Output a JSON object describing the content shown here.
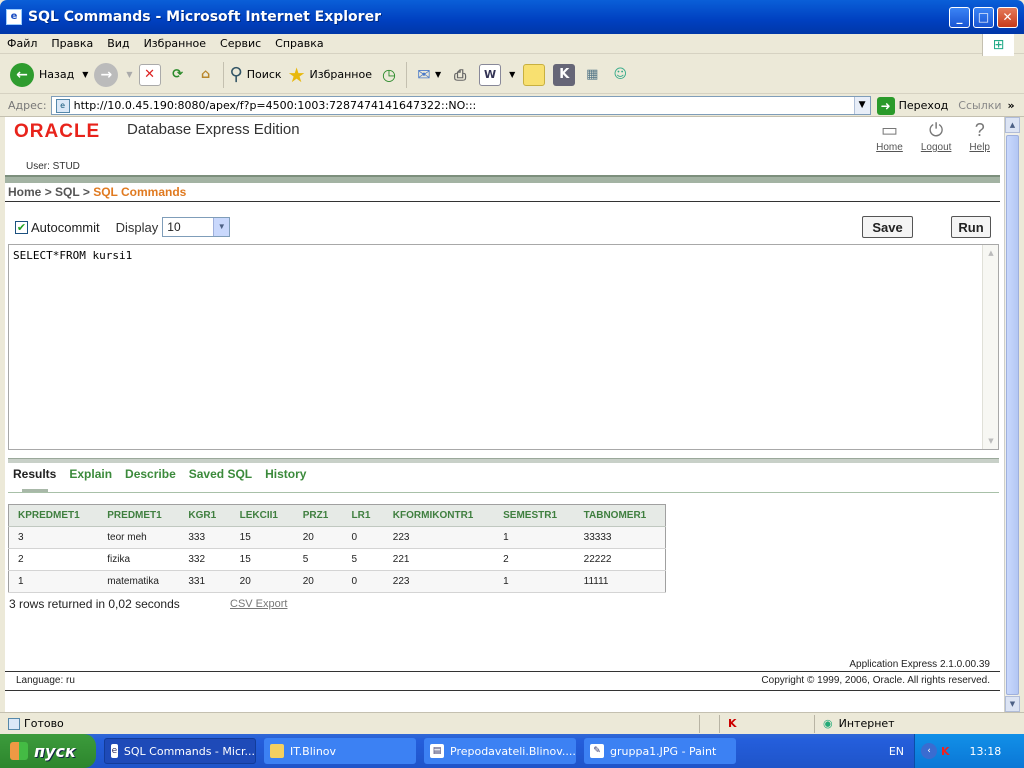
{
  "window": {
    "title": "SQL Commands - Microsoft Internet Explorer"
  },
  "menu": [
    "Файл",
    "Правка",
    "Вид",
    "Избранное",
    "Сервис",
    "Справка"
  ],
  "toolbar": {
    "back": "Назад",
    "search": "Поиск",
    "favorites": "Избранное"
  },
  "address": {
    "label": "Адрес:",
    "url": "http://10.0.45.190:8080/apex/f?p=4500:1003:7287474141647322::NO:::",
    "go": "Переход",
    "links": "Ссылки"
  },
  "header": {
    "logo": "ORACLE",
    "product": "Database Express Edition",
    "user": "User: STUD",
    "home": "Home",
    "logout": "Logout",
    "help": "Help"
  },
  "breadcrumb": {
    "home": "Home",
    "sql": "SQL",
    "current": "SQL Commands",
    "sep": ">"
  },
  "controls": {
    "autocommit": "Autocommit",
    "display_label": "Display",
    "display_value": "10",
    "save": "Save",
    "run": "Run"
  },
  "editor": {
    "sql": "SELECT*FROM kursi1"
  },
  "tabs": [
    "Results",
    "Explain",
    "Describe",
    "Saved SQL",
    "History"
  ],
  "results": {
    "columns": [
      "KPREDMET1",
      "PREDMET1",
      "KGR1",
      "LEKCII1",
      "PRZ1",
      "LR1",
      "KFORMIKONTR1",
      "SEMESTR1",
      "TABNOMER1"
    ],
    "rows": [
      [
        "3",
        "teor meh",
        "333",
        "15",
        "20",
        "0",
        "223",
        "1",
        "33333"
      ],
      [
        "2",
        "fizika",
        "332",
        "15",
        "5",
        "5",
        "221",
        "2",
        "22222"
      ],
      [
        "1",
        "matematika",
        "331",
        "20",
        "20",
        "0",
        "223",
        "1",
        "11111"
      ]
    ],
    "summary": "3 rows returned in 0,02 seconds",
    "csv": "CSV Export"
  },
  "footer": {
    "version": "Application Express 2.1.0.00.39",
    "language": "Language: ru",
    "copyright": "Copyright © 1999, 2006, Oracle. All rights reserved."
  },
  "statusbar": {
    "ready": "Готово",
    "zone": "Интернет"
  },
  "taskbar": {
    "start": "пуск",
    "items": [
      "SQL Commands - Micr...",
      "IT.Blinov",
      "Prepodavateli.Blinov....",
      "gruppa1.JPG - Paint"
    ],
    "lang": "EN",
    "time": "13:18"
  }
}
